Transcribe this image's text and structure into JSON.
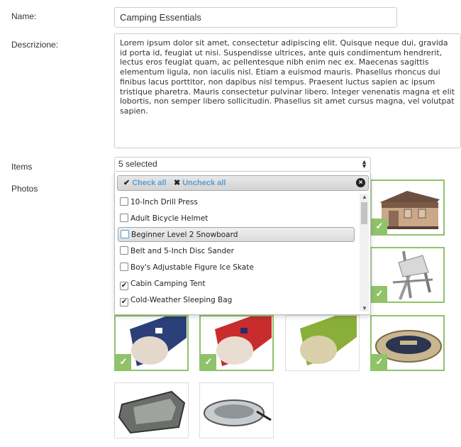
{
  "form": {
    "name_label": "Name:",
    "name_value": "Camping Essentials",
    "desc_label": "Descrizione:",
    "desc_value": "Lorem ipsum dolor sit amet, consectetur adipiscing elit. Quisque neque dui, gravida id porta id, feugiat ut nisi. Suspendisse ultrices, ante quis condimentum hendrerit, lectus eros feugiat quam, ac pellentesque nibh enim nec ex. Maecenas sagittis elementum ligula, non iaculis nisl. Etiam a euismod mauris. Phasellus rhoncus dui finibus lacus porttitor, non dapibus nisl tempus. Praesent luctus sapien ac ipsum tristique pharetra. Mauris consectetur pulvinar libero. Integer venenatis magna et elit lobortis, non semper libero sollicitudin. Phasellus sit amet cursus magna, vel volutpat sapien.",
    "items_label": "Items",
    "items_selected": "5 selected",
    "photos_label": "Photos"
  },
  "dropdown": {
    "check_all": "Check all",
    "uncheck_all": "Uncheck all",
    "options": [
      {
        "label": "10-Inch Drill Press",
        "checked": false
      },
      {
        "label": "Adult Bicycle Helmet",
        "checked": false
      },
      {
        "label": "Beginner Level 2 Snowboard",
        "checked": false,
        "highlighted": true
      },
      {
        "label": "Belt and 5-Inch Disc Sander",
        "checked": false
      },
      {
        "label": "Boy's Adjustable Figure Ice Skate",
        "checked": false
      },
      {
        "label": "Cabin Camping Tent",
        "checked": true
      },
      {
        "label": "Cold-Weather Sleeping Bag",
        "checked": true
      }
    ]
  },
  "photos": [
    {
      "subject": "cabin-tent",
      "selected": true
    },
    {
      "subject": "camp-chair",
      "selected": true
    },
    {
      "subject": "blue-sleeping-bag",
      "selected": true
    },
    {
      "subject": "red-sleeping-bag",
      "selected": true
    },
    {
      "subject": "green-sleeping-bag",
      "selected": false
    },
    {
      "subject": "inflatable-raft",
      "selected": true
    },
    {
      "subject": "gray-inflatable-boat",
      "selected": false
    },
    {
      "subject": "white-raft-with-oars",
      "selected": false
    }
  ],
  "colors": {
    "selected_accent": "#8fc36a",
    "link_blue": "#5b9bd1"
  }
}
